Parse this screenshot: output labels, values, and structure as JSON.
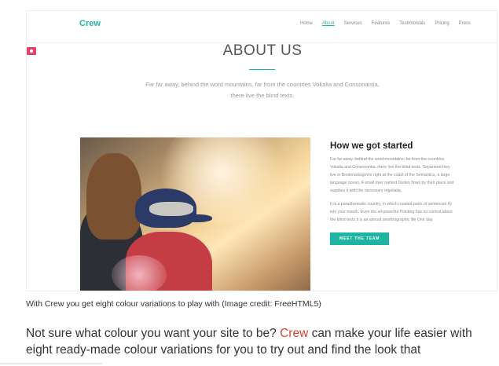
{
  "site": {
    "logo": "Crew",
    "nav": [
      "Home",
      "About",
      "Services",
      "Features",
      "Testimonials",
      "Pricing",
      "Press"
    ],
    "active_nav": "About",
    "heading": "ABOUT US",
    "intro": "Far far away, behind the word mountains, far from the countries Vokalia and Consonantia, there live the blind texts.",
    "aside_title": "How we got started",
    "aside_p1": "Far far away, behind the word mountains, far from the countries Vokalia and Consonantia, there live the blind texts. Separated they live in Bookmarksgrove right at the coast of the Semantics, a large language ocean. A small river named Duden flows by their place and supplies it with the necessary regelialia.",
    "aside_p2": "It is a paradisematic country, in which roasted parts of sentences fly into your mouth. Even the all-powerful Pointing has no control about the blind texts it is an almost unorthographic life One day.",
    "button": "MEET THE TEAM",
    "colors": {
      "accent": "#1fb5a3",
      "pink": "#e2446b"
    }
  },
  "article": {
    "caption": "With Crew you get eight colour variations to play with (Image credit: FreeHTML5)",
    "text_before": "Not sure what colour you want your site to be? ",
    "link": "Crew",
    "text_after": " can make your life easier with eight ready-made colour variations for you to try out and find the look that",
    "link_color": "#d7442c"
  }
}
